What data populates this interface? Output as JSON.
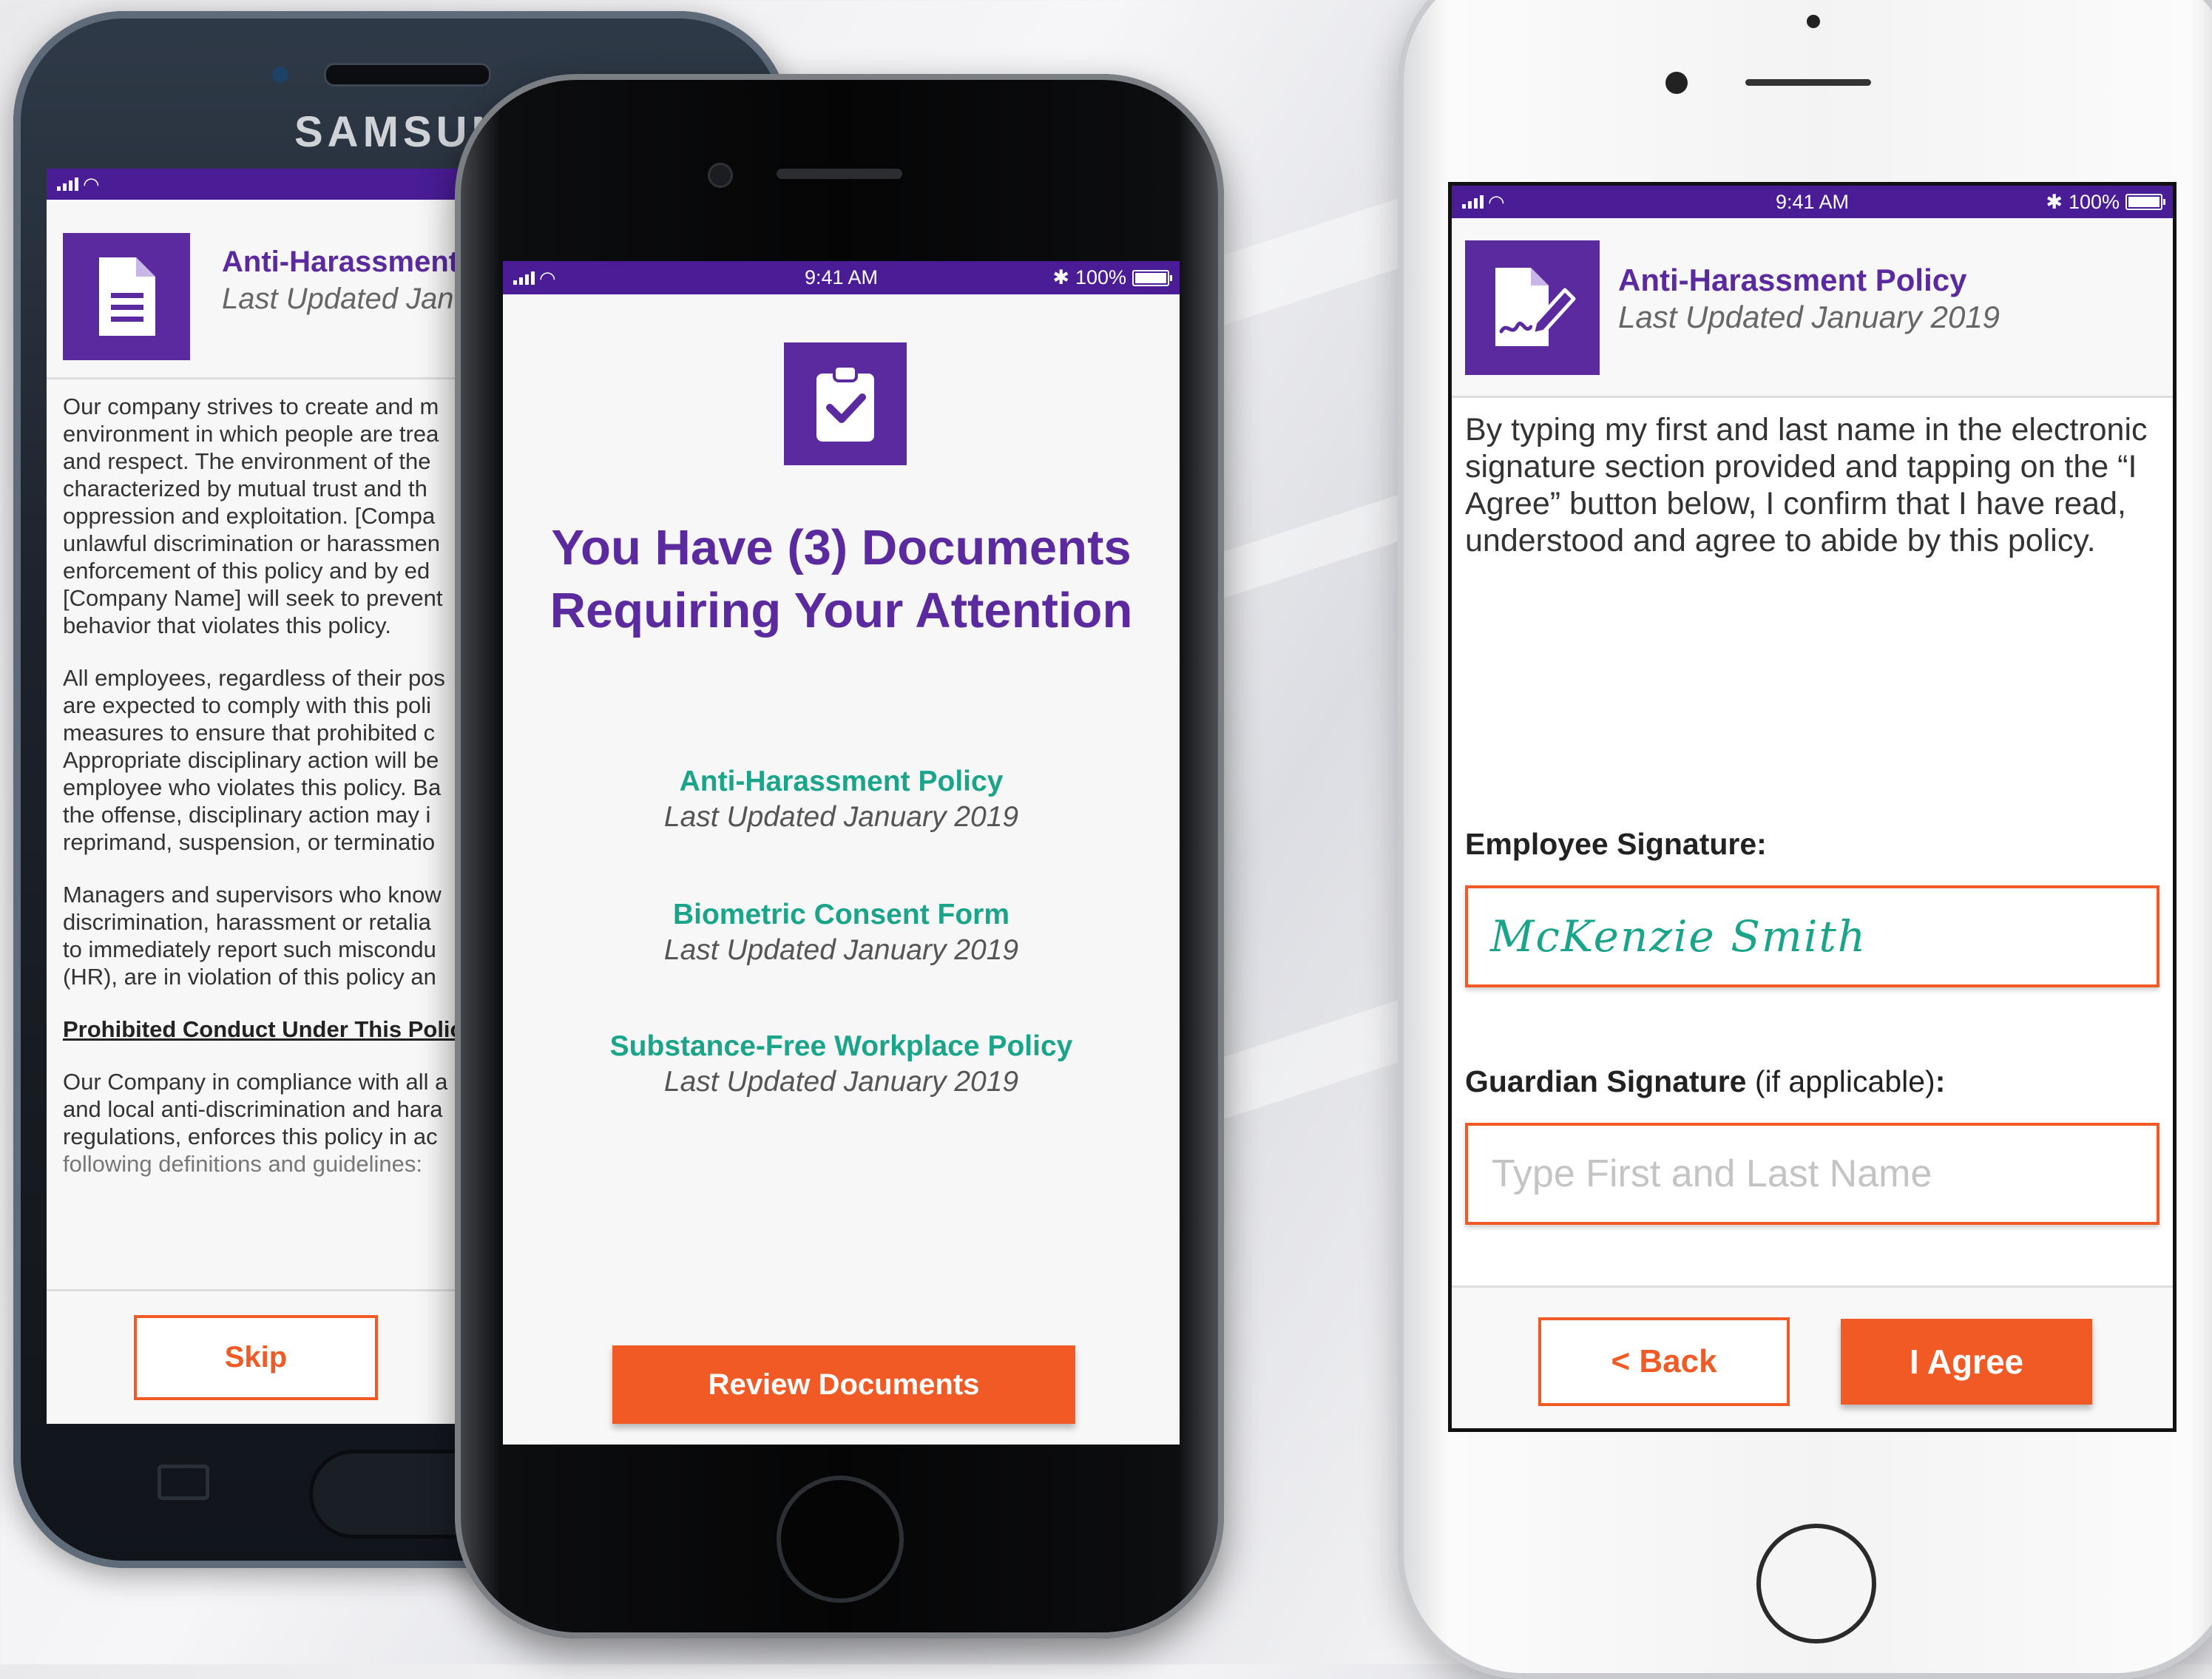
{
  "status_bar": {
    "time": "9:41 AM",
    "battery": "100%"
  },
  "samsung": {
    "brand": "SAMSUNG",
    "header_title": "Anti-Harassment",
    "header_subtitle": "Last Updated Janu",
    "paragraphs": [
      "Our company strives to create and m\nenvironment in which people are trea\nand respect. The environment of the\ncharacterized by mutual trust and th\noppression and exploitation. [Compa\nunlawful discrimination or harassmen\nenforcement of this policy and by ed\n[Company Name] will seek to prevent\nbehavior that violates this policy.",
      "All employees, regardless of their pos\nare expected to comply with this poli\nmeasures to ensure that prohibited c\nAppropriate disciplinary action will be\nemployee who violates this policy. Ba\nthe offense, disciplinary action may i\nreprimand, suspension, or terminatio",
      "Managers and supervisors who know\ndiscrimination, harassment or retalia\nto immediately report such miscondu\n(HR), are in violation of this policy an"
    ],
    "subheading": "Prohibited Conduct Under This Polic",
    "last_paragraph": "Our Company in compliance with all a\nand local anti-discrimination and hara\nregulations, enforces this policy in ac",
    "last_paragraph_faded": "following definitions and guidelines:",
    "skip_label": "Skip"
  },
  "dashboard": {
    "title_line1": "You Have (3) Documents",
    "title_line2": "Requiring Your Attention",
    "documents": [
      {
        "name": "Anti-Harassment Policy",
        "updated": "Last Updated January 2019"
      },
      {
        "name": "Biometric Consent Form",
        "updated": "Last Updated January 2019"
      },
      {
        "name": "Substance-Free Workplace Policy",
        "updated": "Last Updated January 2019"
      }
    ],
    "review_label": "Review Documents"
  },
  "signature_screen": {
    "header_title": "Anti-Harassment Policy",
    "header_subtitle": "Last Updated January 2019",
    "body": "By typing my first and last name in the electronic signature section provided and tapping on the “I Agree” button below, I confirm that I have read, understood and agree to abide by this policy.",
    "employee_label": "Employee Signature:",
    "employee_value": "McKenzie Smith",
    "guardian_label": "Guardian Signature",
    "guardian_note": " (if applicable)",
    "guardian_colon": ":",
    "guardian_placeholder": "Type First and Last Name",
    "back_label": "< Back",
    "agree_label": "I Agree"
  },
  "colors": {
    "purple": "#4a1c96",
    "accent_purple": "#5b2a9e",
    "orange": "#f15a24",
    "teal": "#1aa58b"
  }
}
